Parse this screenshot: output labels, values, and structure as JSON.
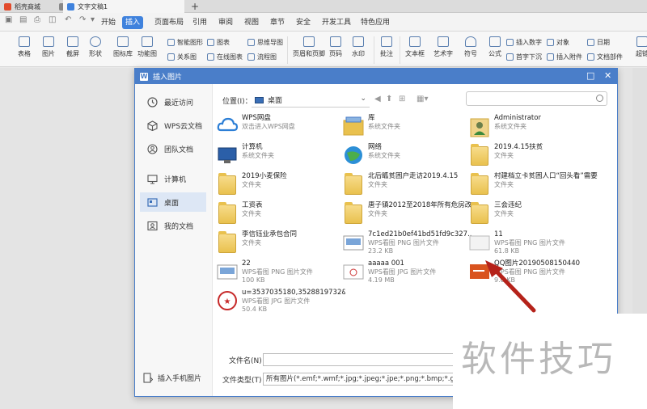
{
  "doc_tabs": [
    {
      "label": "稻壳商城",
      "color": "#e24a2b"
    },
    {
      "label": "文字文稿1",
      "color": "#3f82dd"
    }
  ],
  "new_tab": "+",
  "ribbon_tabs": [
    "开始",
    "插入",
    "页面布局",
    "引用",
    "审阅",
    "视图",
    "章节",
    "安全",
    "开发工具",
    "特色应用"
  ],
  "active_ribbon_tab": "插入",
  "toolbar": {
    "large": [
      "表格",
      "图片",
      "截屏",
      "形状",
      "图标库",
      "功能图",
      "页眉和页脚",
      "页码",
      "水印",
      "批注",
      "文本框",
      "艺术字",
      "符号",
      "公式",
      "超链"
    ],
    "small": [
      "智能图形",
      "关系图",
      "图表",
      "在线图表",
      "思维导图",
      "流程图",
      "插入数字",
      "首字下沉",
      "对象",
      "插入附件",
      "日期",
      "文档部件"
    ]
  },
  "dialog": {
    "title": "插入图片",
    "sidebar": [
      {
        "label": "最近访问",
        "icon": "clock-icon"
      },
      {
        "label": "WPS云文档",
        "icon": "cube-icon"
      },
      {
        "label": "团队文档",
        "icon": "team-icon"
      },
      {
        "label": "计算机",
        "icon": "monitor-icon"
      },
      {
        "label": "桌面",
        "icon": "desktop-icon"
      },
      {
        "label": "我的文档",
        "icon": "mydocs-icon"
      }
    ],
    "selected_sidebar": "桌面",
    "mobile_label": "插入手机图片",
    "location_label": "位置(I)：",
    "location_value": "桌面",
    "search_placeholder": "",
    "files": [
      {
        "name": "WPS网盘",
        "sub1": "双击进入WPS网盘",
        "sub2": "",
        "type": "cloud"
      },
      {
        "name": "库",
        "sub1": "系统文件夹",
        "sub2": "",
        "type": "library"
      },
      {
        "name": "Administrator",
        "sub1": "系统文件夹",
        "sub2": "",
        "type": "user"
      },
      {
        "name": "计算机",
        "sub1": "系统文件夹",
        "sub2": "",
        "type": "computer"
      },
      {
        "name": "网络",
        "sub1": "系统文件夹",
        "sub2": "",
        "type": "network"
      },
      {
        "name": "2019.4.15扶贫",
        "sub1": "文件夹",
        "sub2": "",
        "type": "folder"
      },
      {
        "name": "2019小麦保险",
        "sub1": "文件夹",
        "sub2": "",
        "type": "folder"
      },
      {
        "name": "北后畖贫困户走访2019.4.15",
        "sub1": "文件夹",
        "sub2": "",
        "type": "folder"
      },
      {
        "name": "村建档立卡贫困人口“回头看”需要材料",
        "sub1": "文件夹",
        "sub2": "",
        "type": "folder"
      },
      {
        "name": "工资表",
        "sub1": "文件夹",
        "sub2": "",
        "type": "folder"
      },
      {
        "name": "唐子镇2012至2018年所有危房改造户（2016.2017年无任务）",
        "sub1": "文件夹",
        "sub2": "",
        "type": "folder"
      },
      {
        "name": "三会违纪",
        "sub1": "文件夹",
        "sub2": "",
        "type": "folder"
      },
      {
        "name": "李信钰业承包合同",
        "sub1": "文件夹",
        "sub2": "",
        "type": "folder"
      },
      {
        "name": "7c1ed21b0ef41bd51fd9c327...",
        "sub1": "WPS看图 PNG 图片文件",
        "sub2": "23.2 KB",
        "type": "image"
      },
      {
        "name": "11",
        "sub1": "WPS看图 PNG 图片文件",
        "sub2": "61.8 KB",
        "type": "image-light"
      },
      {
        "name": "22",
        "sub1": "WPS看图 PNG 图片文件",
        "sub2": "100 KB",
        "type": "image"
      },
      {
        "name": "aaaaa 001",
        "sub1": "WPS看图 JPG 图片文件",
        "sub2": "4.19 MB",
        "type": "image-cert"
      },
      {
        "name": "QQ图片20190508150440",
        "sub1": "WPS看图 PNG 图片文件",
        "sub2": "9.6 KB",
        "type": "image-orange"
      },
      {
        "name": "u=3537035180,3528819732&...",
        "sub1": "WPS看图 JPG 图片文件",
        "sub2": "50.4 KB",
        "type": "image-seal"
      }
    ],
    "filename_label": "文件名(N)：",
    "filename_value": "",
    "filetype_label": "文件类型(T)：",
    "filetype_value": "所有图片(*.emf;*.wmf;*.jpg;*.jpeg;*.jpe;*.png;*.bmp;*.gif;*.tif;*.tiff;*.w"
  },
  "watermark_text": "软件技巧"
}
